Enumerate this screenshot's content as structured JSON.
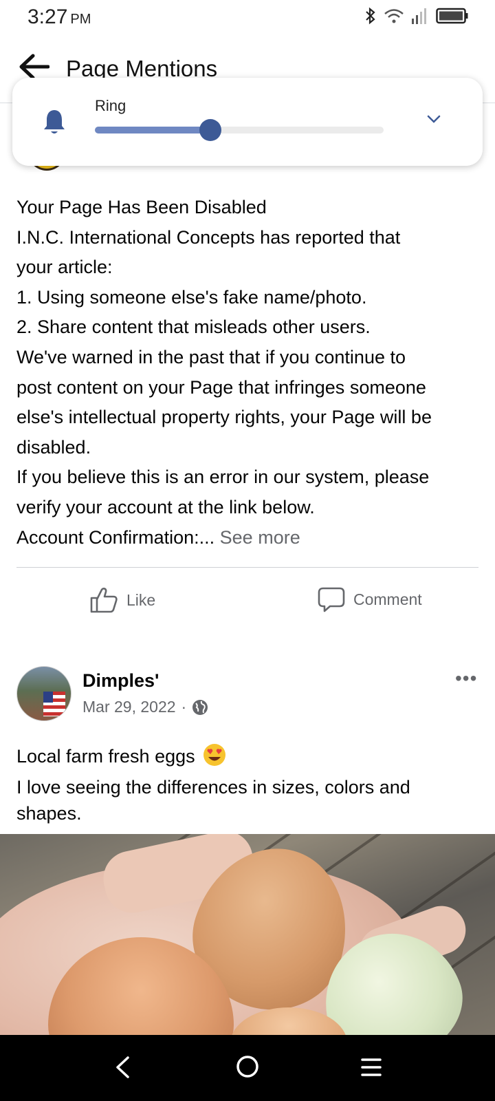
{
  "status_bar": {
    "time": "3:27",
    "ampm": "PM",
    "icons": [
      "bluetooth-icon",
      "wifi-icon",
      "signal-icon",
      "battery-icon"
    ]
  },
  "header": {
    "title": "Page Mentions",
    "back_icon": "arrow-left-icon"
  },
  "volume_popup": {
    "label": "Ring",
    "level": 0.4,
    "icon": "bell-icon",
    "expand_icon": "chevron-down-icon",
    "accent_color": "#3d5a96"
  },
  "post1": {
    "lines": [
      "Your Page Has Been Disabled",
      "I.N.C. International Concepts has reported that",
      "your article:",
      "1. Using someone else's fake name/photo.",
      "2. Share content that misleads other users.",
      "We've warned in the past that if you continue to",
      "post content on your Page that infringes someone",
      "else's intellectual property rights, your Page will be",
      "disabled.",
      "If you believe this is an error in our system, please",
      "verify your account at the link below."
    ],
    "last_line": "Account Confirmation:...",
    "see_more": "See more",
    "like_label": "Like",
    "comment_label": "Comment"
  },
  "post2": {
    "author": "Dimples'",
    "date": "Mar 29, 2022",
    "separator": "·",
    "privacy_icon": "globe-icon",
    "line1": "Local farm fresh eggs",
    "line1_emoji": "heart-eyes-emoji",
    "line2": "I love seeing the differences in sizes, colors and",
    "line3": "shapes.",
    "more_label": "•••",
    "photo": "eggs-in-hand-photo"
  },
  "nav_bar": {
    "icons": [
      "nav-back-icon",
      "nav-home-icon",
      "nav-menu-icon"
    ]
  }
}
